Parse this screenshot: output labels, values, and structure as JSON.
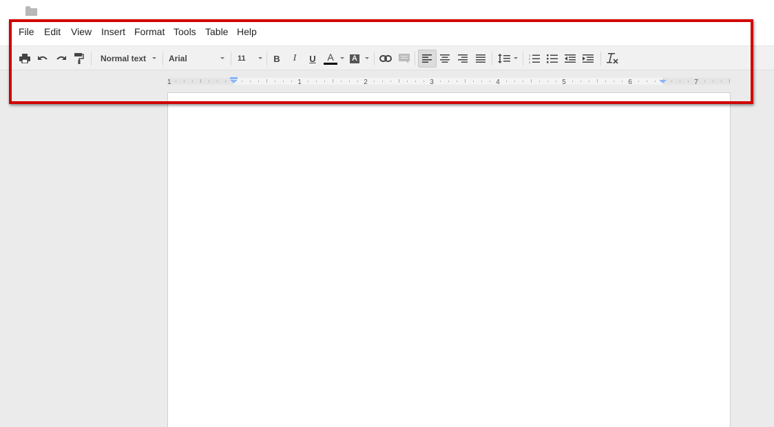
{
  "titlebar": {
    "folder_icon": "folder-icon"
  },
  "menu": {
    "items": [
      {
        "label": "File"
      },
      {
        "label": "Edit"
      },
      {
        "label": "View"
      },
      {
        "label": "Insert"
      },
      {
        "label": "Format"
      },
      {
        "label": "Tools"
      },
      {
        "label": "Table"
      },
      {
        "label": "Help"
      }
    ]
  },
  "toolbar": {
    "style": "Normal text",
    "font": "Arial",
    "font_size": "11",
    "bold": "B",
    "italic": "I",
    "underline": "U",
    "text_color_letter": "A",
    "text_color": "#000000",
    "highlight_letter": "A"
  },
  "ruler": {
    "labels": [
      "1",
      "1",
      "2",
      "3",
      "4",
      "5",
      "6",
      "7"
    ],
    "indent_marker_color": "#8ab4f8"
  },
  "colors": {
    "highlight_border": "#d10000",
    "background": "#ebebeb"
  }
}
